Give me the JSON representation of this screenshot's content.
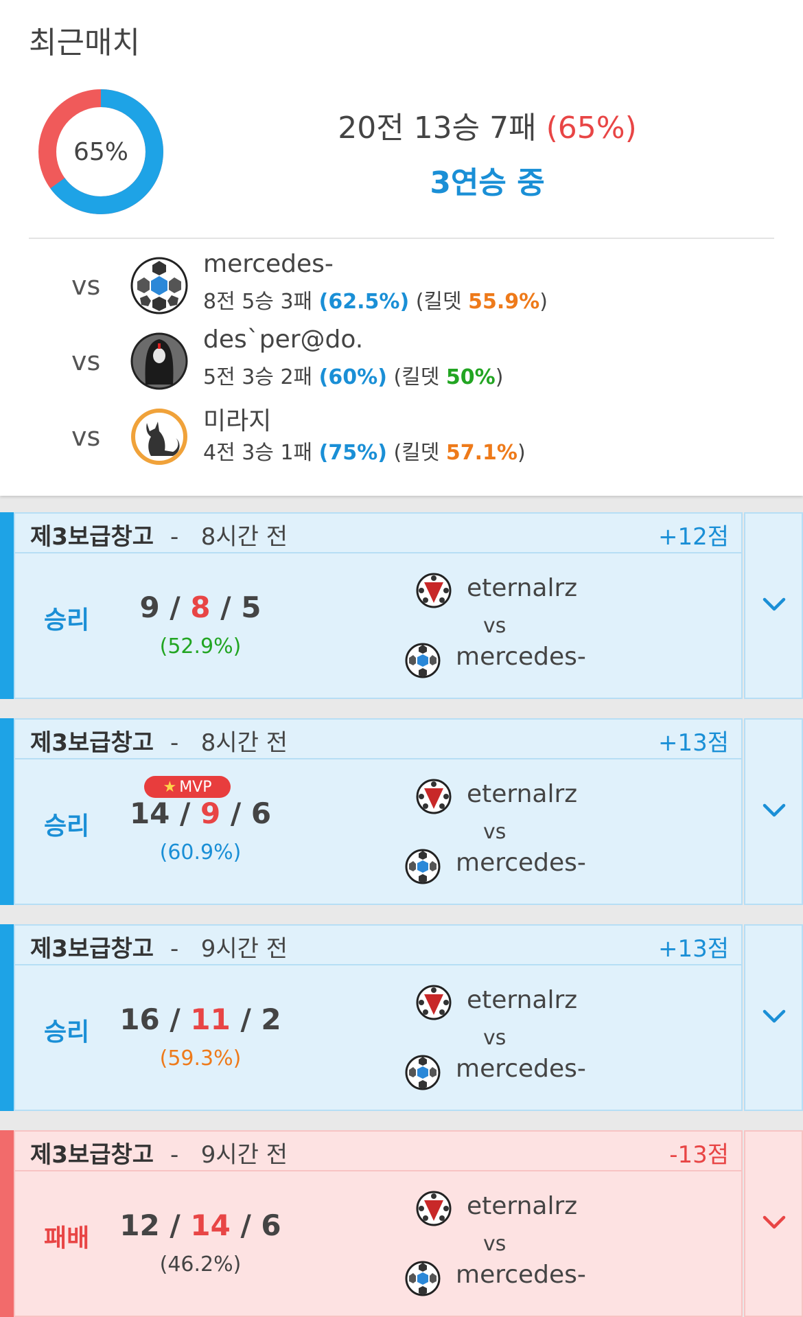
{
  "summary": {
    "title": "최근매치",
    "donut_label": "65%",
    "win_rate": 0.65,
    "record_text": "20전 13승 7패 ",
    "record_pct": "(65%)",
    "streak": "3연승 중"
  },
  "opponents": [
    {
      "vs": "vs",
      "name": "mercedes-",
      "record": "8전 5승 3패 ",
      "winrate": "(62.5%)",
      "kd_prefix": " (킬뎃 ",
      "kd": "55.9%",
      "kd_color": "orange",
      "kd_suffix": ")",
      "avatar": "soccer-ball-icon"
    },
    {
      "vs": "vs",
      "name": "des`per@do.",
      "record": "5전 3승 2패 ",
      "winrate": "(60%)",
      "kd_prefix": " (킬뎃 ",
      "kd": "50%",
      "kd_color": "green",
      "kd_suffix": ")",
      "avatar": "hooded-figure-icon"
    },
    {
      "vs": "vs",
      "name": "미라지",
      "record": "4전 3승 1패 ",
      "winrate": "(75%)",
      "kd_prefix": " (킬뎃 ",
      "kd": "57.1%",
      "kd_color": "orange",
      "kd_suffix": ")",
      "avatar": "black-cat-icon"
    }
  ],
  "matches": [
    {
      "map": "제3보급창고",
      "sep": "-",
      "time": "8시간 전",
      "points": "+12점",
      "result": "승리",
      "kills": "9",
      "deaths": "8",
      "assists": "5",
      "slash": " / ",
      "kill_part": "(52.9%)",
      "kp_color": "green",
      "mvp": "",
      "player1": "eternalrz",
      "vs": "vs",
      "player2": "mercedes-",
      "outcome": "win"
    },
    {
      "map": "제3보급창고",
      "sep": "-",
      "time": "8시간 전",
      "points": "+13점",
      "result": "승리",
      "kills": "14",
      "deaths": "9",
      "assists": "6",
      "slash": " / ",
      "kill_part": "(60.9%)",
      "kp_color": "blue",
      "mvp": "MVP",
      "player1": "eternalrz",
      "vs": "vs",
      "player2": "mercedes-",
      "outcome": "win"
    },
    {
      "map": "제3보급창고",
      "sep": "-",
      "time": "9시간 전",
      "points": "+13점",
      "result": "승리",
      "kills": "16",
      "deaths": "11",
      "assists": "2",
      "slash": " / ",
      "kill_part": "(59.3%)",
      "kp_color": "orange",
      "mvp": "",
      "player1": "eternalrz",
      "vs": "vs",
      "player2": "mercedes-",
      "outcome": "win"
    },
    {
      "map": "제3보급창고",
      "sep": "-",
      "time": "9시간 전",
      "points": "-13점",
      "result": "패배",
      "kills": "12",
      "deaths": "14",
      "assists": "6",
      "slash": " / ",
      "kill_part": "(46.2%)",
      "kp_color": "gray",
      "mvp": "",
      "player1": "eternalrz",
      "vs": "vs",
      "player2": "mercedes-",
      "outcome": "loss"
    }
  ],
  "colors": {
    "win": "#1ea3e6",
    "loss": "#f26b6b",
    "donut_win": "#1ea3e6",
    "donut_loss": "#f05a5a"
  }
}
